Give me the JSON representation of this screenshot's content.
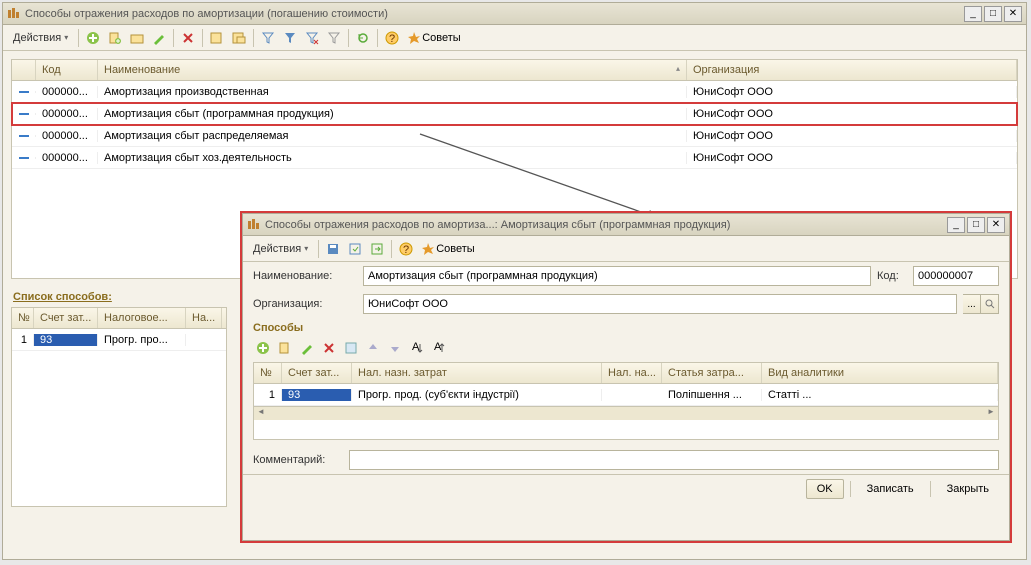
{
  "main": {
    "title": "Способы отражения расходов по амортизации (погашению стоимости)",
    "actions": "Действия",
    "tips": "Советы",
    "columns": {
      "code": "Код",
      "name": "Наименование",
      "org": "Организация"
    },
    "rows": [
      {
        "code": "000000...",
        "name": "Амортизация производственная",
        "org": "ЮниСофт ООО"
      },
      {
        "code": "000000...",
        "name": "Амортизация сбыт (программная продукция)",
        "org": "ЮниСофт ООО"
      },
      {
        "code": "000000...",
        "name": "Амортизация сбыт распределяемая",
        "org": "ЮниСофт ООО"
      },
      {
        "code": "000000...",
        "name": "Амортизация сбыт хоз.деятельность",
        "org": "ЮниСофт ООО"
      }
    ],
    "bottom_label": "Список способов:",
    "bottom_cols": {
      "num": "№",
      "acct": "Счет зат...",
      "tax": "Налоговое...",
      "more": "На..."
    },
    "bottom_row": {
      "num": "1",
      "acct": "93",
      "tax": "Прогр. про..."
    }
  },
  "detail": {
    "title": "Способы отражения расходов по амортиза...: Амортизация сбыт (программная продукция)",
    "actions": "Действия",
    "tips": "Советы",
    "name_label": "Наименование:",
    "name_value": "Амортизация сбыт (программная продукция)",
    "code_label": "Код:",
    "code_value": "000000007",
    "org_label": "Организация:",
    "org_value": "ЮниСофт ООО",
    "sub_header": "Способы",
    "cols": {
      "num": "№",
      "acct": "Счет зат...",
      "tax": "Нал. назн. затрат",
      "taxn": "Нал. на...",
      "article": "Статья затра...",
      "analytic": "Вид аналитики"
    },
    "row": {
      "num": "1",
      "acct": "93",
      "tax": "Прогр. прод. (суб'єкти індустрії)",
      "article": "Поліпшення ...",
      "analytic": "Статті ..."
    },
    "comment_label": "Комментарий:",
    "buttons": {
      "ok": "OK",
      "save": "Записать",
      "close": "Закрыть"
    }
  }
}
